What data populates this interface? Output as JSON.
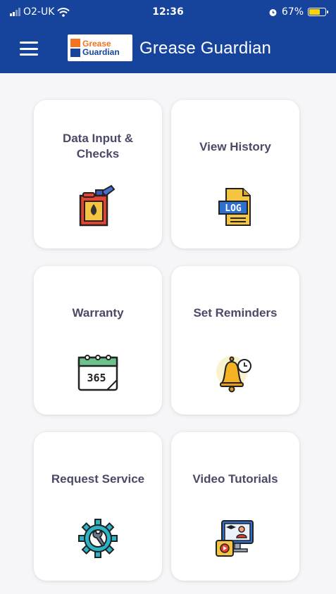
{
  "status_bar": {
    "carrier": "O2-UK",
    "time": "12:36",
    "battery_percent": "67%",
    "battery_level": 0.67
  },
  "header": {
    "logo_line1": "Grease",
    "logo_line2": "Guardian",
    "title": "Grease Guardian"
  },
  "tiles": [
    {
      "label": "Data Input & Checks",
      "icon": "jerrycan-icon"
    },
    {
      "label": "View History",
      "icon": "log-file-icon"
    },
    {
      "label": "Warranty",
      "icon": "calendar-365-icon"
    },
    {
      "label": "Set Reminders",
      "icon": "bell-clock-icon"
    },
    {
      "label": "Request Service",
      "icon": "gear-wrench-icon"
    },
    {
      "label": "Video Tutorials",
      "icon": "video-tutorial-icon"
    }
  ],
  "icons": {
    "log_text": "LOG",
    "calendar_text": "365"
  },
  "colors": {
    "header": "#16449c",
    "brand_orange": "#f37321",
    "tile_text": "#4a4a68",
    "background": "#f6f6f8"
  }
}
